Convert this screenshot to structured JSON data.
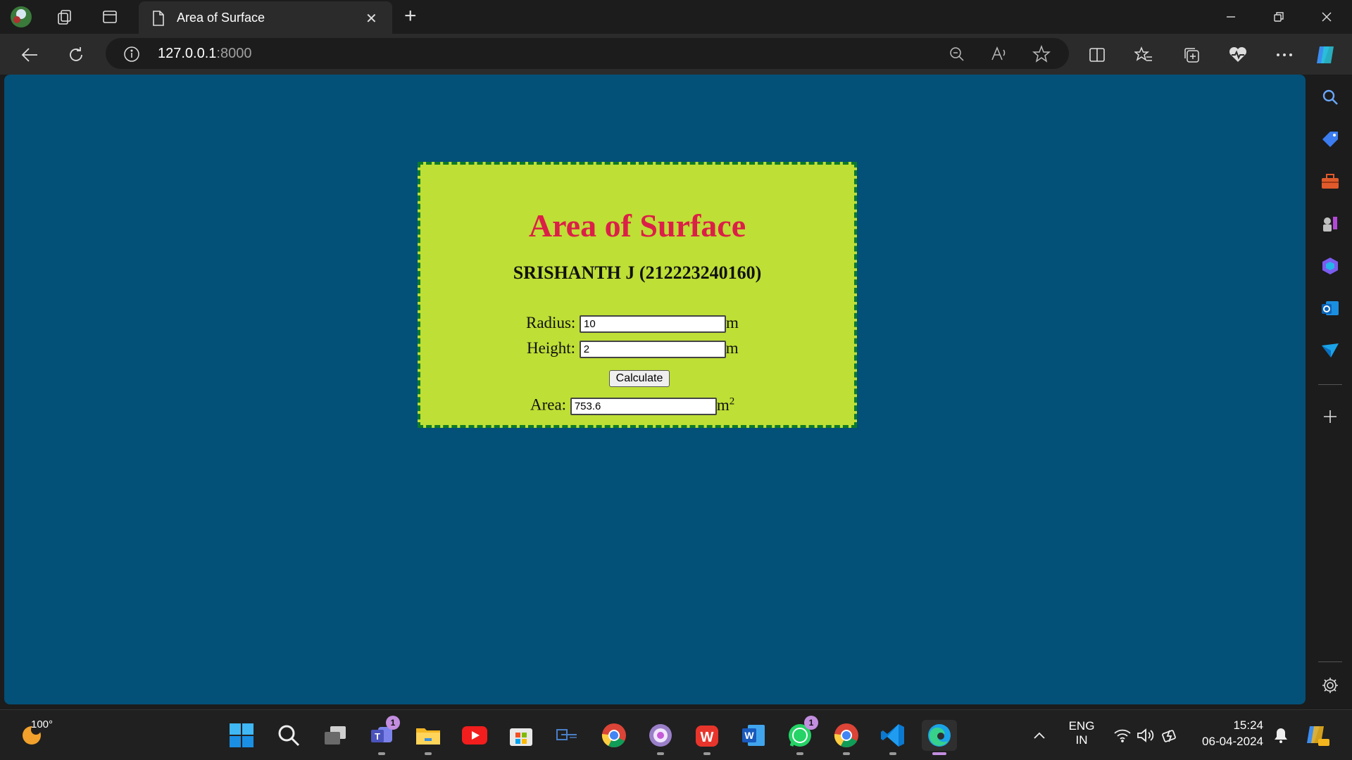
{
  "browser": {
    "tab_title": "Area of Surface",
    "url_host": "127.0.0.1",
    "url_port": ":8000"
  },
  "page": {
    "title": "Area of Surface",
    "author": "SRISHANTH J (212223240160)",
    "radius_label": "Radius:",
    "radius_value": "10",
    "radius_unit": "m",
    "height_label": "Height:",
    "height_value": "2",
    "height_unit": "m",
    "calculate_label": "Calculate",
    "area_label": "Area:",
    "area_value": "753.6",
    "area_unit": "m",
    "area_unit_exp": "2"
  },
  "taskbar": {
    "weather_temp": "100°",
    "teams_badge": "1",
    "whatsapp_badge": "1",
    "word_letter": "W",
    "lang_line1": "ENG",
    "lang_line2": "IN",
    "time": "15:24",
    "date": "06-04-2024"
  },
  "colors": {
    "page_bg": "#035078",
    "card_bg": "#bedf35",
    "card_border": "#0c7a2a",
    "title_color": "#dc1f48"
  }
}
